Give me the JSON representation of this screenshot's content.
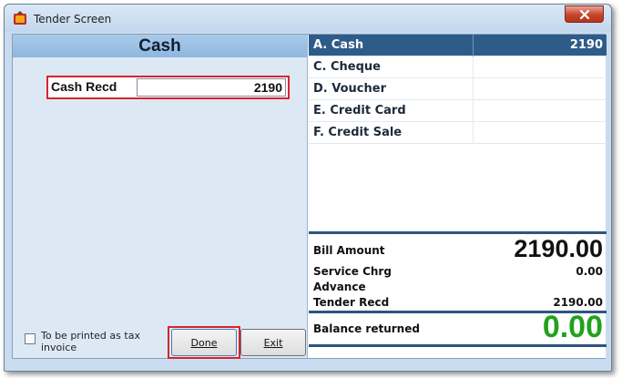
{
  "window": {
    "title": "Tender Screen",
    "close_label": "✕"
  },
  "left_panel": {
    "header": "Cash",
    "cash_recd_label": "Cash Recd",
    "cash_recd_value": "2190",
    "tax_invoice_label": "To be printed as tax invoice",
    "tax_invoice_checked": false,
    "done_label": "Done",
    "exit_label": "Exit"
  },
  "tender_list": [
    {
      "label": "A. Cash",
      "amount": "2190",
      "selected": true
    },
    {
      "label": "C. Cheque",
      "amount": "",
      "selected": false
    },
    {
      "label": "D. Voucher",
      "amount": "",
      "selected": false
    },
    {
      "label": "E. Credit Card",
      "amount": "",
      "selected": false
    },
    {
      "label": "F. Credit Sale",
      "amount": "",
      "selected": false
    }
  ],
  "summary": {
    "bill_amount_label": "Bill Amount",
    "bill_amount_value": "2190.00",
    "service_chrg_label": "Service Chrg",
    "service_chrg_value": "0.00",
    "advance_label": "Advance",
    "advance_value": "",
    "tender_recd_label": "Tender Recd",
    "tender_recd_value": "2190.00",
    "balance_label": "Balance returned",
    "balance_value": "0.00"
  },
  "colors": {
    "selected_row": "#2e5c8a",
    "balance_green": "#21a21b",
    "highlight_red": "#d8232f"
  }
}
